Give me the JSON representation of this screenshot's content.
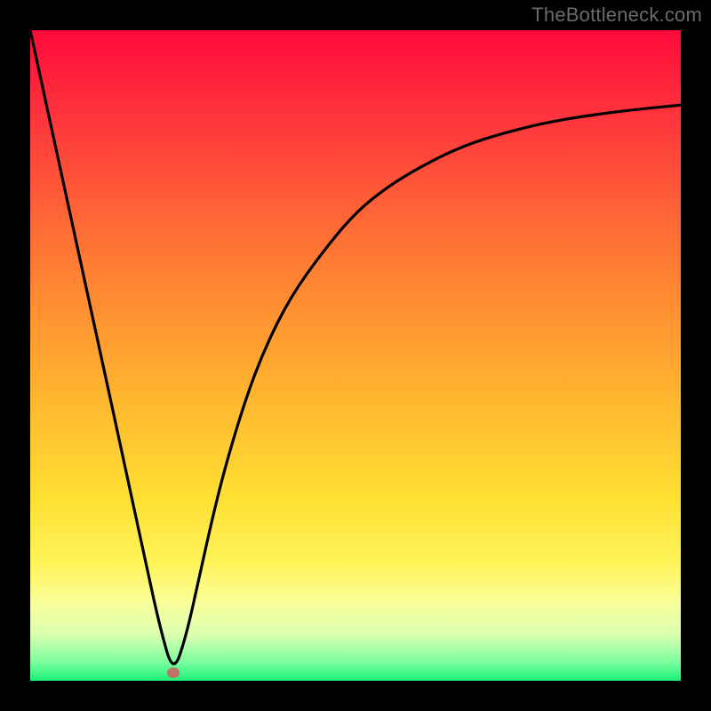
{
  "watermark": "TheBottleneck.com",
  "colors": {
    "background_black": "#000000",
    "gradient_stops": [
      {
        "offset": 0.0,
        "color": "#ff0a3a"
      },
      {
        "offset": 0.15,
        "color": "#ff3a3c"
      },
      {
        "offset": 0.35,
        "color": "#ff7a34"
      },
      {
        "offset": 0.55,
        "color": "#ffb22f"
      },
      {
        "offset": 0.72,
        "color": "#ffe033"
      },
      {
        "offset": 0.82,
        "color": "#fff45a"
      },
      {
        "offset": 0.88,
        "color": "#faff9a"
      },
      {
        "offset": 0.93,
        "color": "#d9ffb0"
      },
      {
        "offset": 0.97,
        "color": "#7fff9f"
      },
      {
        "offset": 1.0,
        "color": "#1cf07a"
      }
    ],
    "curve": "#000000",
    "marker": "#c17166"
  },
  "chart_data": {
    "type": "line",
    "title": "",
    "xlabel": "",
    "ylabel": "",
    "xlim": [
      0,
      100
    ],
    "ylim": [
      0,
      100
    ],
    "marker": {
      "x": 22,
      "y": 1.2
    },
    "series": [
      {
        "name": "bottleneck-curve",
        "x": [
          0,
          5,
          10,
          15,
          18,
          20,
          22,
          24,
          26,
          28,
          30,
          33,
          36,
          40,
          45,
          50,
          55,
          60,
          66,
          72,
          80,
          90,
          100
        ],
        "y": [
          100,
          77,
          54,
          31,
          17,
          8,
          1,
          7,
          16,
          25,
          33,
          43,
          51,
          59,
          66,
          72,
          76,
          79,
          82,
          84,
          86,
          87.5,
          88.5
        ]
      }
    ]
  }
}
